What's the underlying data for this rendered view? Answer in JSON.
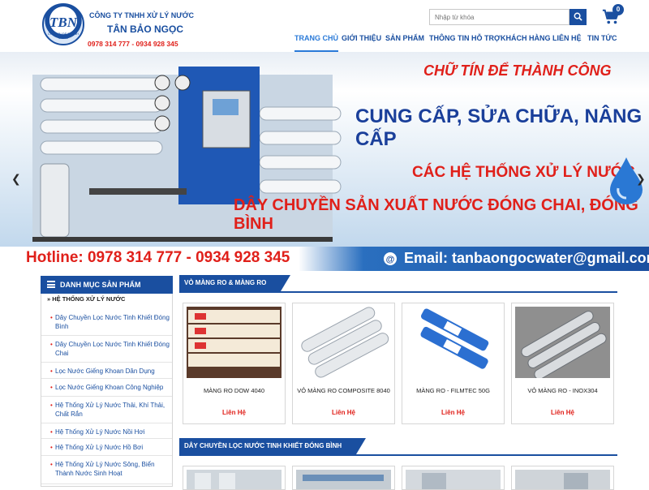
{
  "header": {
    "logo_text": "TBN",
    "logo_tagline": "CHỮ TÍN ĐỂ THÀNH CÔNG",
    "company_line1": "CÔNG TY TNHH XỬ LÝ NƯỚC",
    "company_line2": "TÂN BẢO NGỌC",
    "phone": "0978 314 777 - 0934 928 345",
    "search_placeholder": "Nhập từ khóa",
    "cart_count": "0",
    "accent": "#1a4fa0"
  },
  "nav": [
    {
      "label": "TRANG CHỦ",
      "active": true
    },
    {
      "label": "GIỚI THIỆU"
    },
    {
      "label": "SẢN PHẨM"
    },
    {
      "label": "THÔNG TIN HỖ TRỢ"
    },
    {
      "label": "KHÁCH HÀNG"
    },
    {
      "label": "LIÊN HỆ"
    },
    {
      "label": "TIN TỨC"
    }
  ],
  "banner": {
    "title": "CHỮ TÍN ĐỂ THÀNH CÔNG",
    "line1": "CUNG CẤP, SỬA CHỮA, NÂNG CẤP",
    "line2": "CÁC HỆ THỐNG XỬ LÝ NƯỚC",
    "line3": "DÂY CHUYỀN SẢN XUẤT NƯỚC ĐÓNG CHAI, ĐÓNG BÌNH",
    "hotline": "Hotline: 0978 314 777 - 0934 928 345",
    "email": "Email: tanbaongocwater@gmail.com"
  },
  "sidebar": {
    "heading": "DANH MỤC SẢN PHẨM",
    "group": "HỆ THỐNG XỬ LÝ NƯỚC",
    "items": [
      {
        "label": "Dây Chuyền Lọc Nước Tinh Khiết Đóng Bình"
      },
      {
        "label": "Dây Chuyền Lọc Nước Tinh Khiết Đóng Chai"
      },
      {
        "label": "Lọc Nước Giếng Khoan Dân Dụng"
      },
      {
        "label": "Lọc Nước Giếng Khoan Công Nghiệp"
      },
      {
        "label": "Hệ Thống Xử Lý Nước Thải, Khí Thải, Chất Rắn"
      },
      {
        "label": "Hệ Thống Xử Lý Nước Nồi Hơi"
      },
      {
        "label": "Hệ Thống Xử Lý Nước Hồ Bơi"
      },
      {
        "label": "Hệ Thống Xử Lý Nước Sông, Biển Thành Nước Sinh Hoạt"
      }
    ]
  },
  "sections": [
    {
      "title": "VỎ MÀNG RO & MÀNG RO",
      "products": [
        {
          "name": "MÀNG RO DOW 4040",
          "price": "Liên Hệ"
        },
        {
          "name": "VỎ MÀNG RO COMPOSITE 8040",
          "price": "Liên Hệ"
        },
        {
          "name": "MÀNG RO - FILMTEC 50G",
          "price": "Liên Hệ"
        },
        {
          "name": "VỎ MÀNG RO - INOX304",
          "price": "Liên Hệ"
        }
      ]
    },
    {
      "title": "DÂY CHUYỀN LỌC NƯỚC TINH KHIẾT ĐÓNG BÌNH"
    }
  ]
}
